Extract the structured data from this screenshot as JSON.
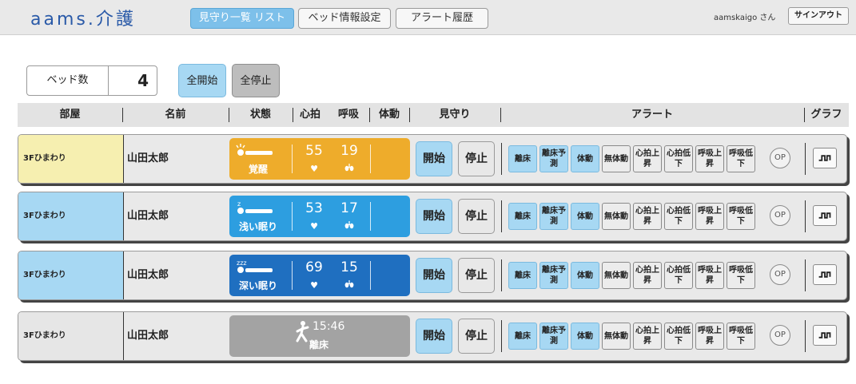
{
  "app": {
    "logo": "aams.介護",
    "nav": {
      "list": "見守り一覧 リスト",
      "bed_settings": "ベッド情報設定",
      "alert_history": "アラート履歴"
    },
    "user": "aamskaigo さん",
    "signout": "サインアウト"
  },
  "controls": {
    "bed_count_label": "ベッド数",
    "bed_count": "4",
    "start_all": "全開始",
    "stop_all": "全停止"
  },
  "columns": {
    "room": "部屋",
    "name": "名前",
    "state": "状態",
    "heart": "心拍",
    "breath": "呼吸",
    "movement": "体動",
    "watch": "見守り",
    "alert": "アラート",
    "graph": "グラフ"
  },
  "rows": [
    {
      "room": "3Fひまわり",
      "name": "山田太郎",
      "status": "覚醒",
      "heart": "55",
      "breath": "19",
      "room_color": "#f6efb0",
      "status_color": "#eeac2b",
      "watch_start": "開始",
      "watch_stop": "停止",
      "alerts": [
        {
          "label": "離床",
          "on": true
        },
        {
          "label": "離床予測",
          "on": true
        },
        {
          "label": "体動",
          "on": true
        },
        {
          "label": "無体動",
          "on": false
        },
        {
          "label": "心拍上昇",
          "on": false
        },
        {
          "label": "心拍低下",
          "on": false
        },
        {
          "label": "呼吸上昇",
          "on": false
        },
        {
          "label": "呼吸低下",
          "on": false
        }
      ],
      "op": "OP"
    },
    {
      "room": "3Fひまわり",
      "name": "山田太郎",
      "status": "浅い眠り",
      "heart": "53",
      "breath": "17",
      "room_color": "#a7d8f3",
      "status_color": "#2d9ee0",
      "watch_start": "開始",
      "watch_stop": "停止",
      "alerts": [
        {
          "label": "離床",
          "on": true
        },
        {
          "label": "離床予測",
          "on": true
        },
        {
          "label": "体動",
          "on": true
        },
        {
          "label": "無体動",
          "on": false
        },
        {
          "label": "心拍上昇",
          "on": false
        },
        {
          "label": "心拍低下",
          "on": false
        },
        {
          "label": "呼吸上昇",
          "on": false
        },
        {
          "label": "呼吸低下",
          "on": false
        }
      ],
      "op": "OP"
    },
    {
      "room": "3Fひまわり",
      "name": "山田太郎",
      "status": "深い眠り",
      "heart": "69",
      "breath": "15",
      "room_color": "#a7d8f3",
      "status_color": "#1f6fc0",
      "watch_start": "開始",
      "watch_stop": "停止",
      "alerts": [
        {
          "label": "離床",
          "on": true
        },
        {
          "label": "離床予測",
          "on": true
        },
        {
          "label": "体動",
          "on": true
        },
        {
          "label": "無体動",
          "on": false
        },
        {
          "label": "心拍上昇",
          "on": false
        },
        {
          "label": "心拍低下",
          "on": false
        },
        {
          "label": "呼吸上昇",
          "on": false
        },
        {
          "label": "呼吸低下",
          "on": false
        }
      ],
      "op": "OP"
    },
    {
      "room": "3Fひまわり",
      "name": "山田太郎",
      "status": "離床",
      "away_time": "15:46",
      "room_color": "#e6e6e6",
      "status_color": "#a3a3a3",
      "watch_start": "開始",
      "watch_stop": "停止",
      "alerts": [
        {
          "label": "離床",
          "on": true
        },
        {
          "label": "離床予測",
          "on": true
        },
        {
          "label": "体動",
          "on": true
        },
        {
          "label": "無体動",
          "on": false
        },
        {
          "label": "心拍上昇",
          "on": false
        },
        {
          "label": "心拍低下",
          "on": false
        },
        {
          "label": "呼吸上昇",
          "on": false
        },
        {
          "label": "呼吸低下",
          "on": false
        }
      ],
      "op": "OP"
    }
  ],
  "icons": {
    "heart": "heart-icon",
    "lungs": "lungs-icon",
    "graph": "graph-icon",
    "sleep_awake": "awake-person-icon",
    "sleep_light": "light-sleep-icon",
    "sleep_deep": "deep-sleep-icon",
    "walking": "walking-person-icon"
  }
}
